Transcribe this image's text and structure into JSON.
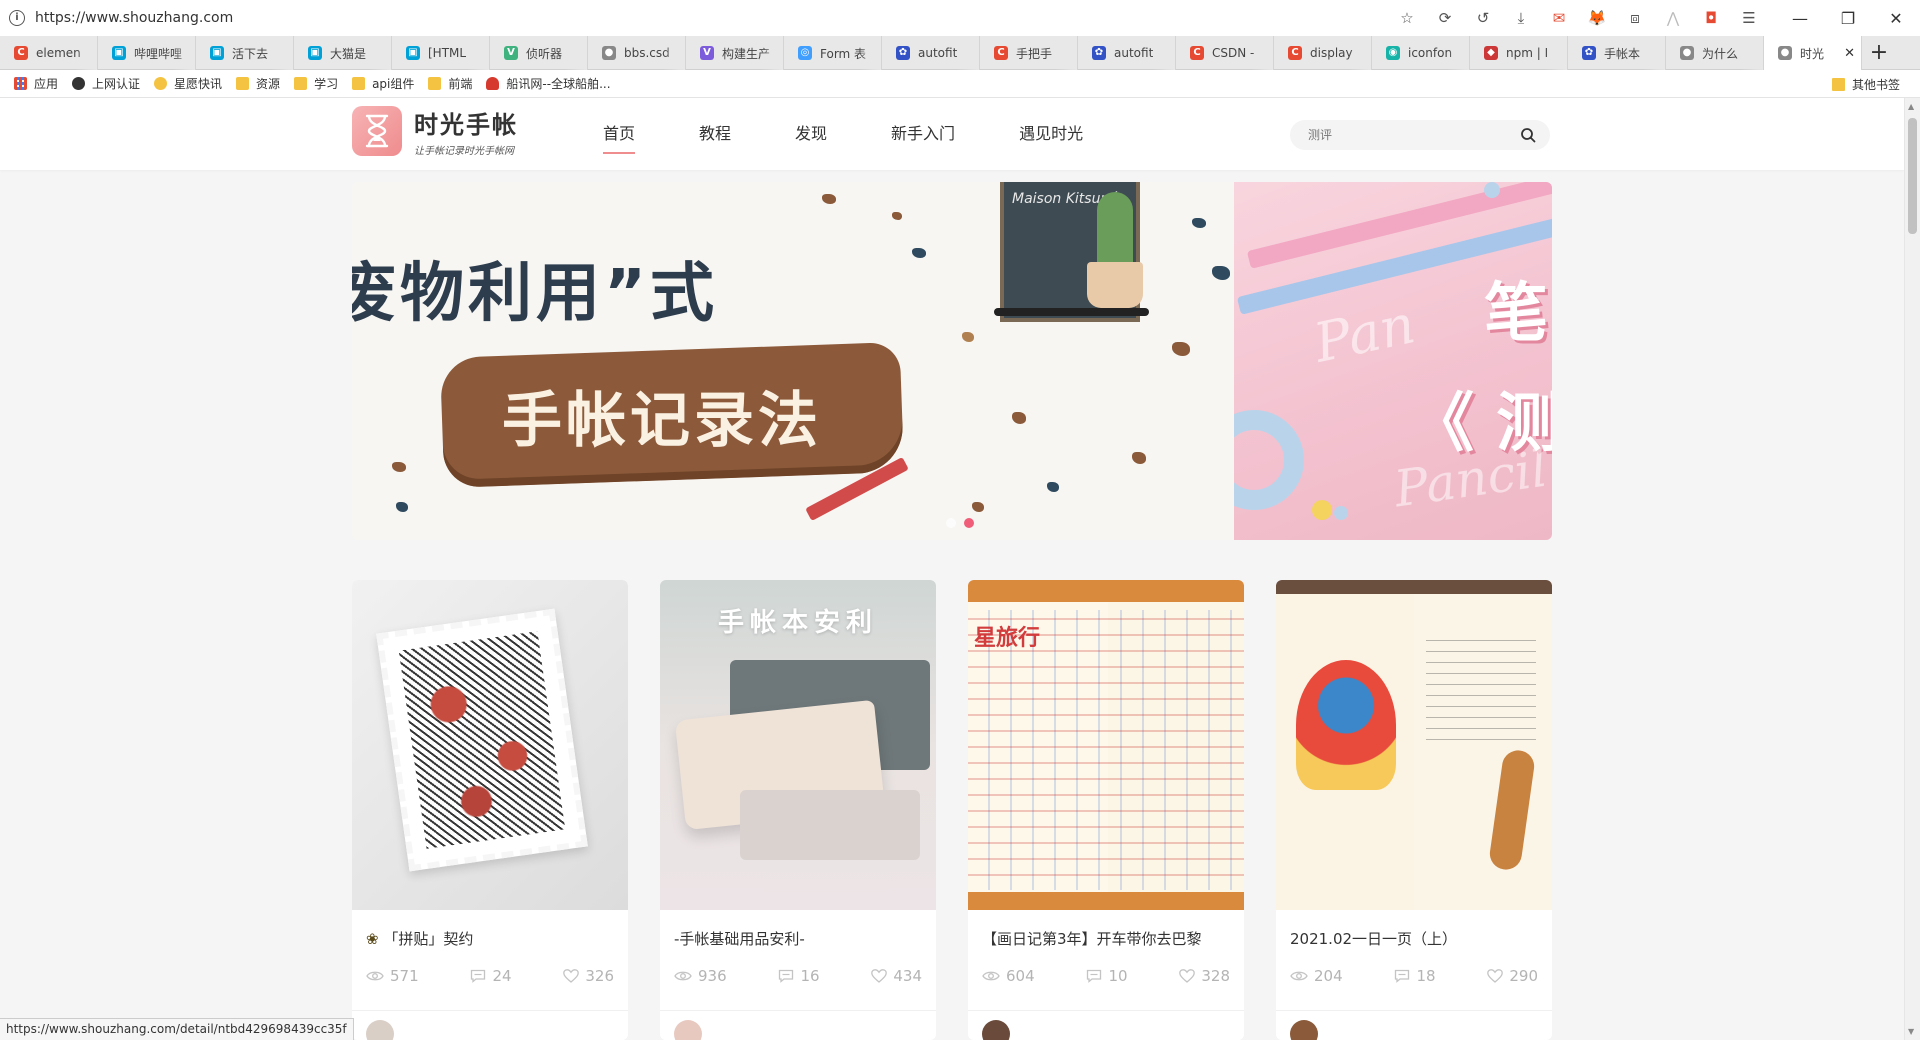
{
  "browser": {
    "url": "https://www.shouzhang.com",
    "tabs": [
      {
        "label": "elemen",
        "color": "#e64a32",
        "glyph": "C"
      },
      {
        "label": "哔哩哔哩",
        "color": "#00a1d6",
        "glyph": "▣"
      },
      {
        "label": "活下去",
        "color": "#00a1d6",
        "glyph": "▣"
      },
      {
        "label": "大猫是",
        "color": "#00a1d6",
        "glyph": "▣"
      },
      {
        "label": "[HTML",
        "color": "#00a1d6",
        "glyph": "▣"
      },
      {
        "label": "侦听器",
        "color": "#3fb27f",
        "glyph": "V"
      },
      {
        "label": "bbs.csd",
        "color": "#888888",
        "glyph": "●"
      },
      {
        "label": "构建生产",
        "color": "#7c5cdb",
        "glyph": "V"
      },
      {
        "label": "Form 表",
        "color": "#409eff",
        "glyph": "◎"
      },
      {
        "label": "autofit",
        "color": "#3352c6",
        "glyph": "✿"
      },
      {
        "label": "手把手",
        "color": "#e64a32",
        "glyph": "C"
      },
      {
        "label": "autofit",
        "color": "#3352c6",
        "glyph": "✿"
      },
      {
        "label": "CSDN -",
        "color": "#e64a32",
        "glyph": "C"
      },
      {
        "label": "display",
        "color": "#e64a32",
        "glyph": "C"
      },
      {
        "label": "iconfon",
        "color": "#17b3a8",
        "glyph": "◉"
      },
      {
        "label": "npm | I",
        "color": "#cb3837",
        "glyph": "◆"
      },
      {
        "label": "手帐本",
        "color": "#3352c6",
        "glyph": "✿"
      },
      {
        "label": "为什么",
        "color": "#888888",
        "glyph": "●"
      },
      {
        "label": "时光",
        "color": "#888888",
        "glyph": "●",
        "active": true
      }
    ],
    "bookmarks": [
      {
        "label": "应用",
        "icon": "apps-icon"
      },
      {
        "label": "上网认证",
        "icon": "globe-icon"
      },
      {
        "label": "星愿快讯",
        "icon": "star-icon"
      },
      {
        "label": "资源",
        "icon": "folder-icon"
      },
      {
        "label": "学习",
        "icon": "folder-icon"
      },
      {
        "label": "api组件",
        "icon": "folder-icon"
      },
      {
        "label": "前端",
        "icon": "folder-icon"
      },
      {
        "label": "船讯网--全球船舶...",
        "icon": "ship-icon"
      }
    ],
    "other_bookmarks": "其他书签",
    "status_url": "https://www.shouzhang.com/detail/ntbd429698439cc35f"
  },
  "site": {
    "logo_title": "时光手帐",
    "logo_sub": "让手帐记录时光手帐网",
    "nav": [
      "首页",
      "教程",
      "发现",
      "新手入门",
      "遇见时光"
    ],
    "search_placeholder": "测评",
    "banner": {
      "left_headline": "废物利用”式",
      "left_label": "手帐记录法",
      "chalk_text": "Maison Kitsuné",
      "right_head1": "笔",
      "right_head2": "《 测",
      "right_script1": "Pan",
      "right_script2": "Pancil"
    },
    "cards": [
      {
        "emoji": "❀",
        "title": "「拼贴」契约",
        "views": "571",
        "comments": "24",
        "likes": "326"
      },
      {
        "emoji": "",
        "title": "-手帐基础用品安利-",
        "views": "936",
        "comments": "16",
        "likes": "434",
        "overlay": "手帐本安利"
      },
      {
        "emoji": "",
        "title": "【画日记第3年】开车带你去巴黎",
        "views": "604",
        "comments": "10",
        "likes": "328",
        "overlay": "星旅行"
      },
      {
        "emoji": "",
        "title": "2021.02一日一页（上）",
        "views": "204",
        "comments": "18",
        "likes": "290"
      }
    ]
  }
}
